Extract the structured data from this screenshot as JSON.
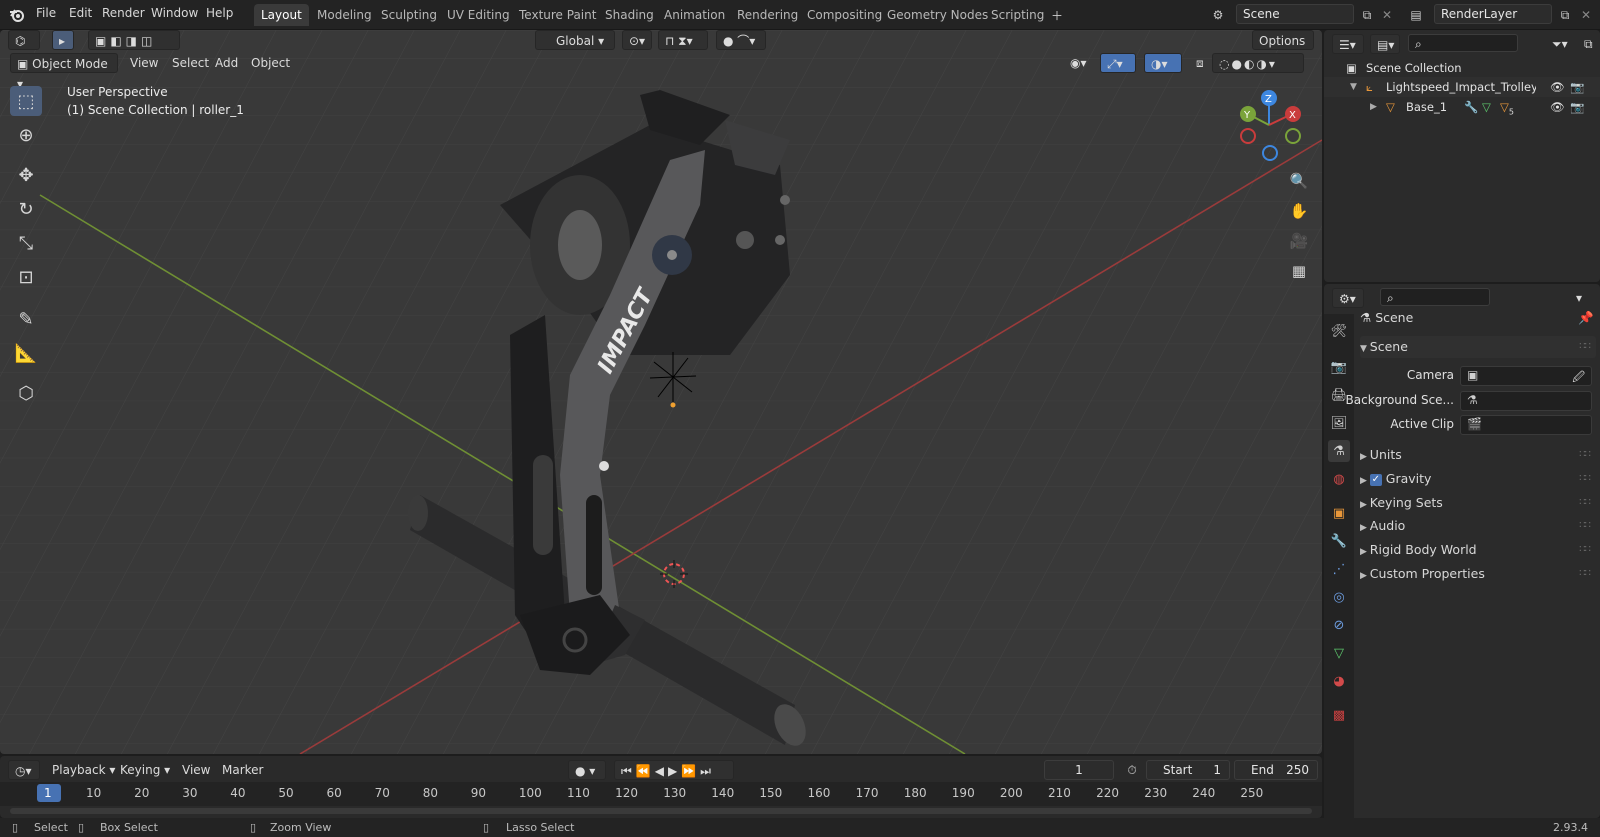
{
  "menu": {
    "file": "File",
    "edit": "Edit",
    "render": "Render",
    "window": "Window",
    "help": "Help"
  },
  "workspaces": [
    "Layout",
    "Modeling",
    "Sculpting",
    "UV Editing",
    "Texture Paint",
    "Shading",
    "Animation",
    "Rendering",
    "Compositing",
    "Geometry Nodes",
    "Scripting"
  ],
  "active_workspace": "Layout",
  "scene_field": "Scene",
  "view_layer_field": "RenderLayer",
  "viewport": {
    "mode": "Object Mode",
    "menus": {
      "view": "View",
      "select": "Select",
      "add": "Add",
      "object": "Object"
    },
    "transform_orientation": "Global",
    "options": "Options",
    "info_line1": "User Perspective",
    "info_line2": "(1) Scene Collection | roller_1",
    "gizmo": {
      "x": "X",
      "y": "Y",
      "z": "Z"
    },
    "logo_text": "IMPACT"
  },
  "timeline": {
    "menus": {
      "playback": "Playback",
      "keying": "Keying",
      "view": "View",
      "marker": "Marker"
    },
    "current_frame": "1",
    "start_label": "Start",
    "start_value": "1",
    "end_label": "End",
    "end_value": "250",
    "ticks": [
      "1",
      "10",
      "20",
      "30",
      "40",
      "50",
      "60",
      "70",
      "80",
      "90",
      "100",
      "110",
      "120",
      "130",
      "140",
      "150",
      "160",
      "170",
      "180",
      "190",
      "200",
      "210",
      "220",
      "230",
      "240",
      "250"
    ]
  },
  "status": {
    "select": "Select",
    "box_select": "Box Select",
    "zoom_view": "Zoom View",
    "lasso_select": "Lasso Select",
    "version": "2.93.4"
  },
  "outliner": {
    "root": "Scene Collection",
    "items": [
      {
        "label": "Lightspeed_Impact_Trolley_C"
      },
      {
        "label": "Base_1"
      }
    ],
    "badge_count": "5"
  },
  "properties": {
    "context": "Scene",
    "panel_title": "Scene",
    "fields": [
      {
        "label": "Camera"
      },
      {
        "label": "Background Sce..."
      },
      {
        "label": "Active Clip"
      }
    ],
    "subpanels": [
      "Units",
      "Gravity",
      "Keying Sets",
      "Audio",
      "Rigid Body World",
      "Custom Properties"
    ],
    "gravity_checked": true
  },
  "colors": {
    "accent": "#4772b3",
    "active_tab": "#3a3a3a",
    "x_axis": "#c93c3c",
    "y_axis": "#7aa33a",
    "z_axis": "#3d87e0"
  }
}
